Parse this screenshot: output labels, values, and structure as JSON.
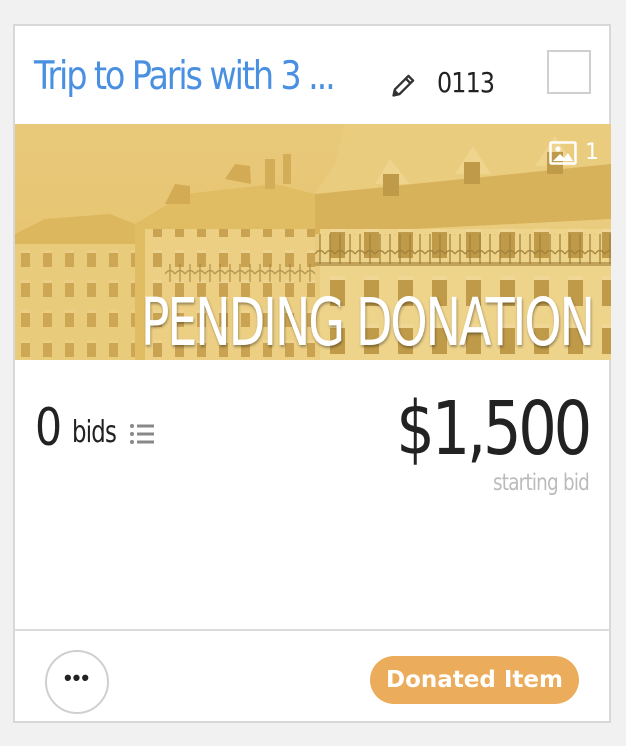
{
  "colors": {
    "title": "#4a90e2",
    "text": "#222222",
    "muted": "#bbbbbb",
    "overlay_text": "#ffffff",
    "badge_bg": "#ebac5c",
    "badge_text": "#ffffff",
    "image_tint": "#e8c466"
  },
  "item": {
    "title": "Trip to Paris with 3 ...",
    "number": "0113",
    "photo_count": "1",
    "status_overlay": "PENDING DONATION",
    "bids_count": "0",
    "bids_label": "bids",
    "price": "$1,500",
    "price_caption": "starting bid",
    "badge": "Donated Item",
    "more_label": "•••"
  },
  "icons": {
    "edit": "pencil-icon",
    "photo": "image-icon",
    "bids": "list-icon",
    "more": "more-horizontal-icon"
  }
}
